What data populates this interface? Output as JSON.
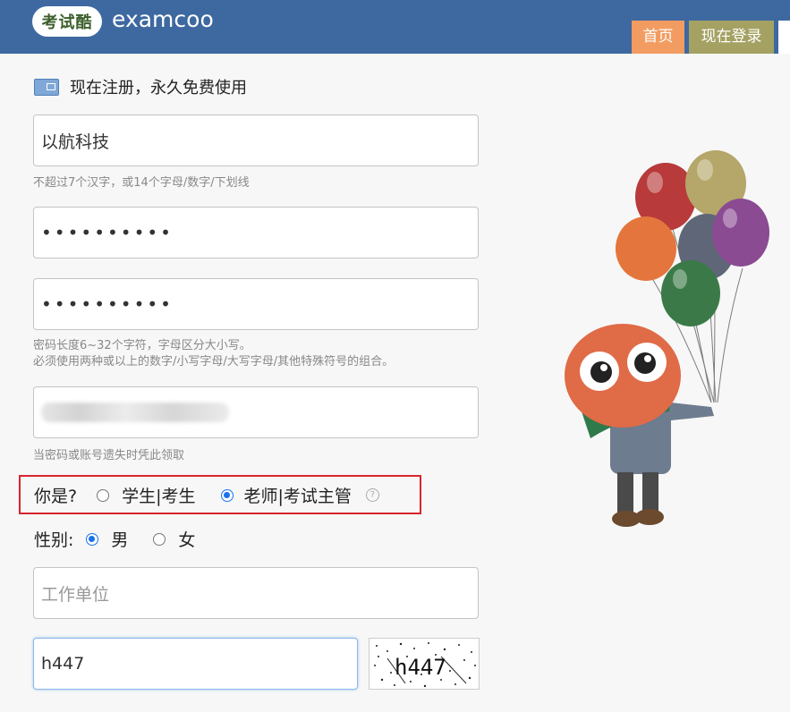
{
  "header": {
    "logo_badge": "考试酷",
    "logo_text": "examcoo",
    "nav": [
      {
        "label": "首页"
      },
      {
        "label": "现在登录"
      }
    ]
  },
  "form": {
    "title": "现在注册，永久免费使用",
    "username": {
      "value": "以航科技",
      "hint": "不超过7个汉字，或14个字母/数字/下划线"
    },
    "password": {
      "masked_value": "••••••••••"
    },
    "password_confirm": {
      "masked_value": "••••••••••",
      "hint_line1": "密码长度6~32个字符，字母区分大小写。",
      "hint_line2": "必须使用两种或以上的数字/小写字母/大写字母/其他特殊符号的组合。"
    },
    "email": {
      "hint": "当密码或账号遗失时凭此领取"
    },
    "role": {
      "label": "你是?",
      "options": [
        "学生|考生",
        "老师|考试主管"
      ],
      "selected": "老师|考试主管",
      "help": "?"
    },
    "gender": {
      "label": "性别:",
      "options": [
        "男",
        "女"
      ],
      "selected": "男"
    },
    "organization": {
      "placeholder": "工作单位"
    },
    "captcha": {
      "value": "h447",
      "image_text": "h447"
    }
  },
  "colors": {
    "header_bg": "#3e68a0",
    "nav_home_bg": "#f39c61",
    "nav_login_bg": "#a4a163",
    "role_box_border": "#d6262d",
    "radio_checked": "#1a73e8"
  }
}
